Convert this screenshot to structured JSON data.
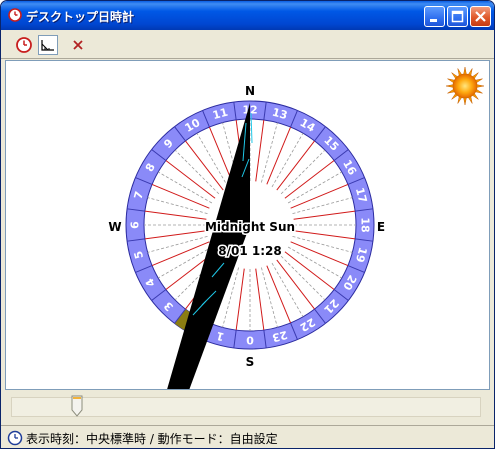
{
  "window": {
    "title": "デスクトップ日時計"
  },
  "toolbar": {
    "clock_tool": "clock-icon",
    "sundial_tool": "sundial-icon",
    "close_tool": "close-x-icon"
  },
  "dial": {
    "north": "N",
    "south": "S",
    "east": "E",
    "west": "W",
    "main_label": "Midnight Sun",
    "time_label": "8/01 1:28",
    "hours": [
      "12",
      "13",
      "14",
      "15",
      "16",
      "17",
      "18",
      "19",
      "20",
      "21",
      "22",
      "23",
      "0",
      "1",
      "2",
      "3",
      "4",
      "5",
      "6",
      "7",
      "8",
      "9",
      "10",
      "11"
    ],
    "highlight_hour": "2"
  },
  "slider": {
    "value": 0.13
  },
  "status": {
    "text": "表示時刻：中央標準時 / 動作モード：自由設定"
  },
  "colors": {
    "ring": "#8A8AF8",
    "highlight": "#8B7D12",
    "shadow": "#000000",
    "sun": "#F59A00"
  }
}
